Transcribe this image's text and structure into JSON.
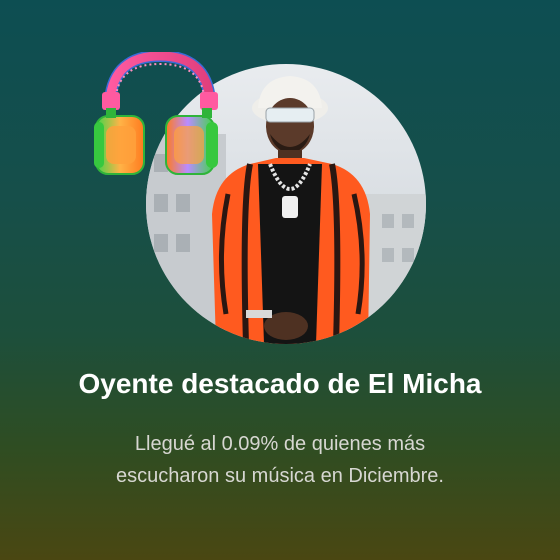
{
  "card": {
    "title": "Oyente destacado de El Micha",
    "subtitle_line1": "Llegué al 0.09% de quienes más",
    "subtitle_line2": "escucharon su música en Diciembre.",
    "icons": {
      "headphones": "headphones-icon"
    },
    "colors": {
      "background_top": "#0d4e52",
      "background_bottom": "#4a4712",
      "jacket": "#ff5a1f",
      "headband": "#e8488a"
    }
  }
}
